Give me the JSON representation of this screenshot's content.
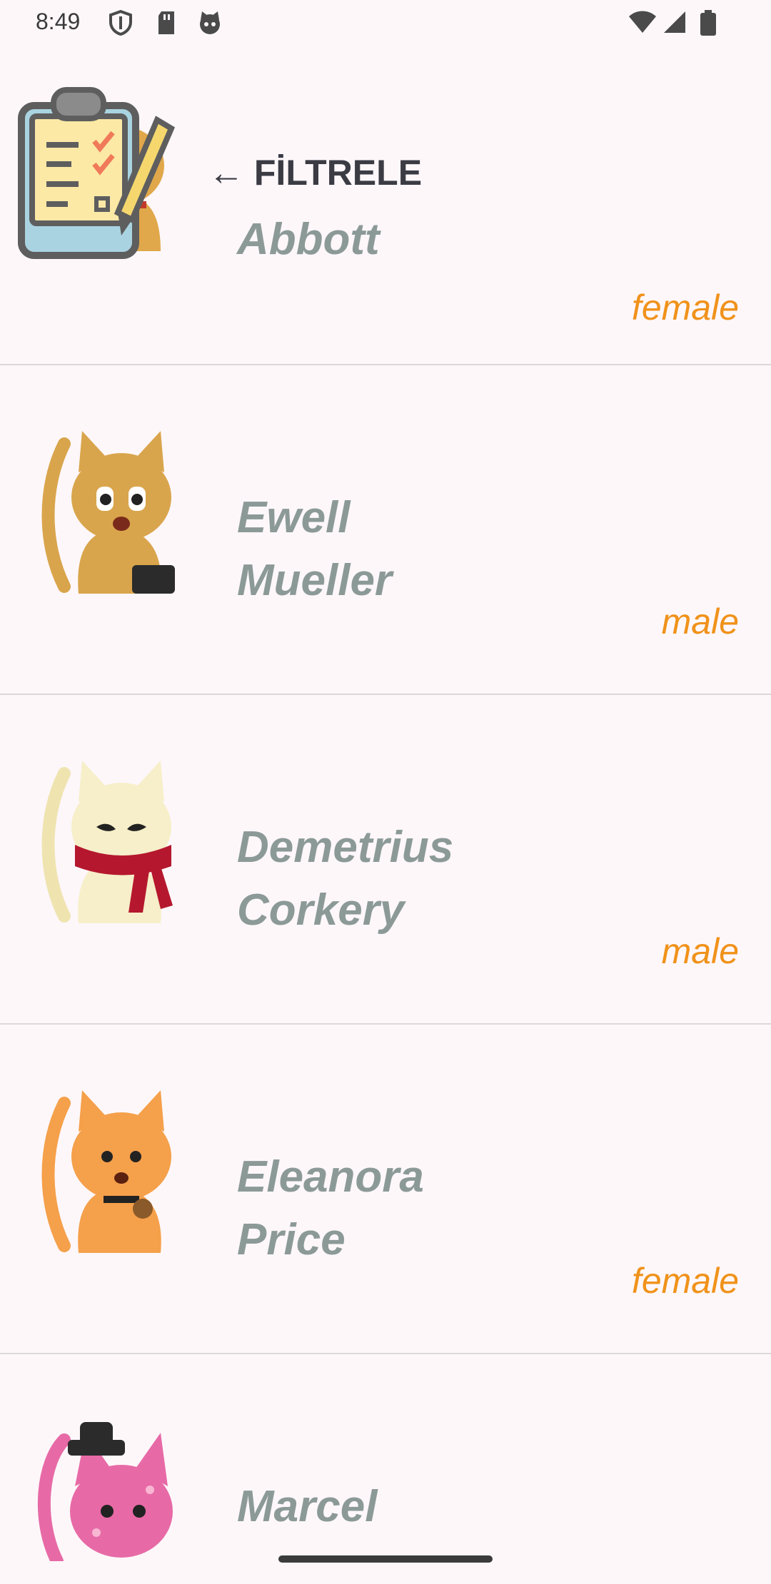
{
  "status_bar": {
    "time": "8:49",
    "left_icons": [
      "shield-icon",
      "sd-card-icon",
      "cat-face-icon"
    ],
    "right_icons": [
      "wifi-icon",
      "signal-icon",
      "battery-icon"
    ]
  },
  "filter": {
    "label": "← FİLTRELE",
    "icon": "clipboard-checklist-icon"
  },
  "cats": [
    {
      "first": "",
      "last": "Abbott",
      "gender": "female",
      "color": "#e0a84a"
    },
    {
      "first": "Ewell",
      "last": "Mueller",
      "gender": "male",
      "color": "#d9a54c"
    },
    {
      "first": "Demetrius",
      "last": "Corkery",
      "gender": "male",
      "color": "#f6efc9"
    },
    {
      "first": "Eleanora",
      "last": "Price",
      "gender": "female",
      "color": "#f5a04a"
    },
    {
      "first": "Marcel",
      "last": "",
      "gender": "",
      "color": "#e76aa6"
    }
  ],
  "colors": {
    "background": "#fdf7fa",
    "name_text": "#8c9a97",
    "gender_text": "#f0921a",
    "divider": "#dcd8da"
  }
}
